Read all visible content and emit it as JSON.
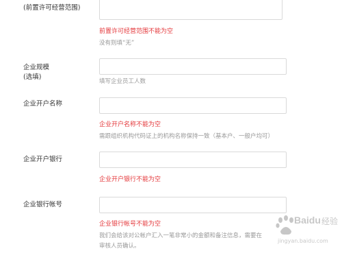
{
  "scope": {
    "label": "(前置许可经营范围)",
    "error": "前置许可经营范围不能为空",
    "hint": "没有则填“无”"
  },
  "scale": {
    "label_line1": "企业规模",
    "label_line2": "(选填)",
    "hint": "填写企业员工人数"
  },
  "account_name": {
    "label": "企业开户名称",
    "error": "企业开户名称不能为空",
    "hint": "需跟组织机构代码证上的机构名称保持一致（基本户、一般户均可）"
  },
  "bank": {
    "label": "企业开户银行",
    "error": "企业开户银行不能为空"
  },
  "account_no": {
    "label": "企业银行帐号",
    "error": "企业银行帐号不能为空",
    "hint_line1": "我们会给该对公帐户汇入一笔非常小的金额和备注信息，需要在",
    "hint_line2": "审核人员确认。"
  },
  "watermark": {
    "brand": "Baidu",
    "suffix": "经验",
    "url": "jingyan.baidu.com"
  }
}
